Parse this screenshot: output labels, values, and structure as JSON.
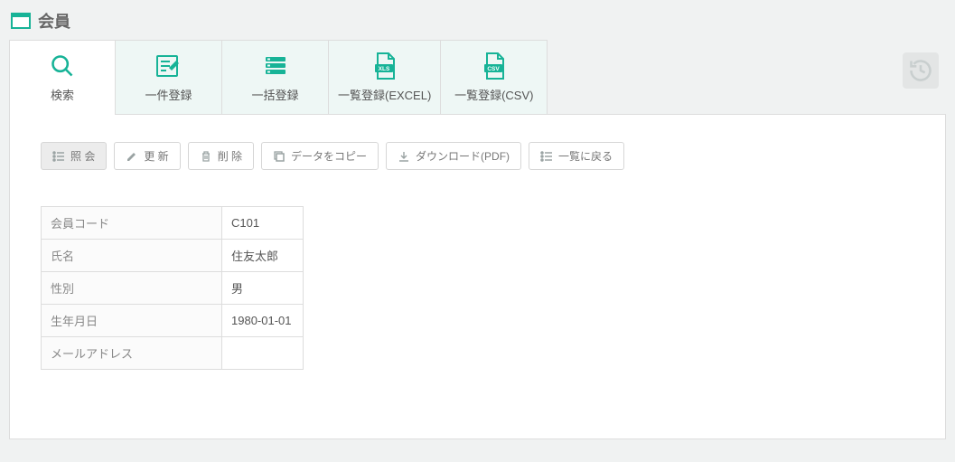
{
  "page": {
    "title": "会員"
  },
  "tabs": [
    {
      "label": "検索"
    },
    {
      "label": "一件登録"
    },
    {
      "label": "一括登録"
    },
    {
      "label": "一覧登録(EXCEL)"
    },
    {
      "label": "一覧登録(CSV)"
    }
  ],
  "toolbar": {
    "view": "照 会",
    "edit": "更 新",
    "delete": "削 除",
    "copy": "データをコピー",
    "download": "ダウンロード(PDF)",
    "back": "一覧に戻る"
  },
  "detail": {
    "rows": [
      {
        "label": "会員コード",
        "value": "C101"
      },
      {
        "label": "氏名",
        "value": "住友太郎"
      },
      {
        "label": "性別",
        "value": "男"
      },
      {
        "label": "生年月日",
        "value": "1980-01-01"
      },
      {
        "label": "メールアドレス",
        "value": ""
      }
    ]
  }
}
